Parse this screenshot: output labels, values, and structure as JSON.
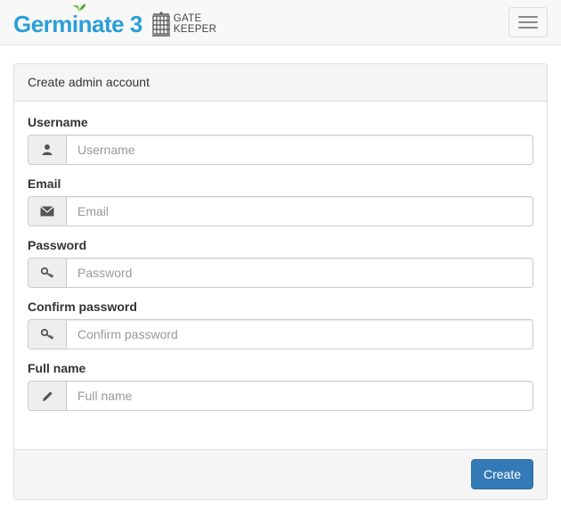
{
  "brand": {
    "name": "Germinate 3",
    "partner_logo_line1": "GATE",
    "partner_logo_line2": "KEEPER",
    "accent_color": "#2a9fd6"
  },
  "navbar": {
    "toggle_icon": "hamburger-menu-icon"
  },
  "form": {
    "heading": "Create admin account",
    "fields": [
      {
        "label": "Username",
        "placeholder": "Username",
        "value": "",
        "icon": "user-icon"
      },
      {
        "label": "Email",
        "placeholder": "Email",
        "value": "",
        "icon": "envelope-icon"
      },
      {
        "label": "Password",
        "placeholder": "Password",
        "value": "",
        "icon": "key-icon"
      },
      {
        "label": "Confirm password",
        "placeholder": "Confirm password",
        "value": "",
        "icon": "key-icon"
      },
      {
        "label": "Full name",
        "placeholder": "Full name",
        "value": "",
        "icon": "pencil-icon"
      }
    ],
    "submit_label": "Create",
    "primary_color": "#337ab7"
  }
}
